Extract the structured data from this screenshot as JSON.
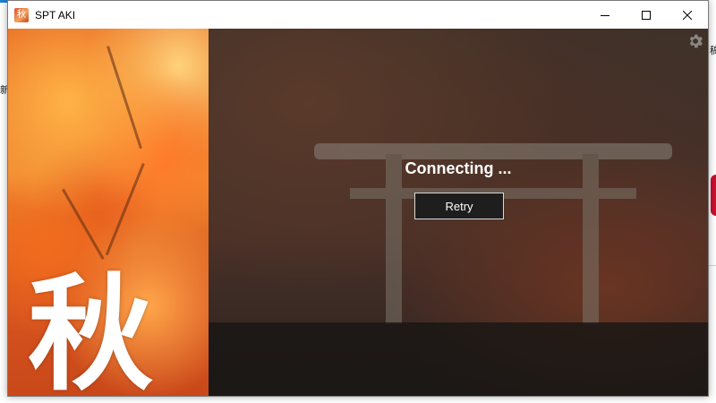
{
  "window": {
    "title": "SPT AKI",
    "controls": {
      "minimize_icon": "minimize-icon",
      "maximize_icon": "maximize-icon",
      "close_icon": "close-icon"
    }
  },
  "art": {
    "kanji": "秋",
    "icon_glyph": "秋"
  },
  "main": {
    "status_text": "Connecting ...",
    "retry_label": "Retry",
    "settings_icon": "gear-icon"
  },
  "desktop": {
    "left_glyph": "新",
    "right_glyph": "稿"
  },
  "colors": {
    "accent_orange": "#e86a25",
    "dark_bg": "#1b1613",
    "button_border": "#d8d8d8"
  }
}
